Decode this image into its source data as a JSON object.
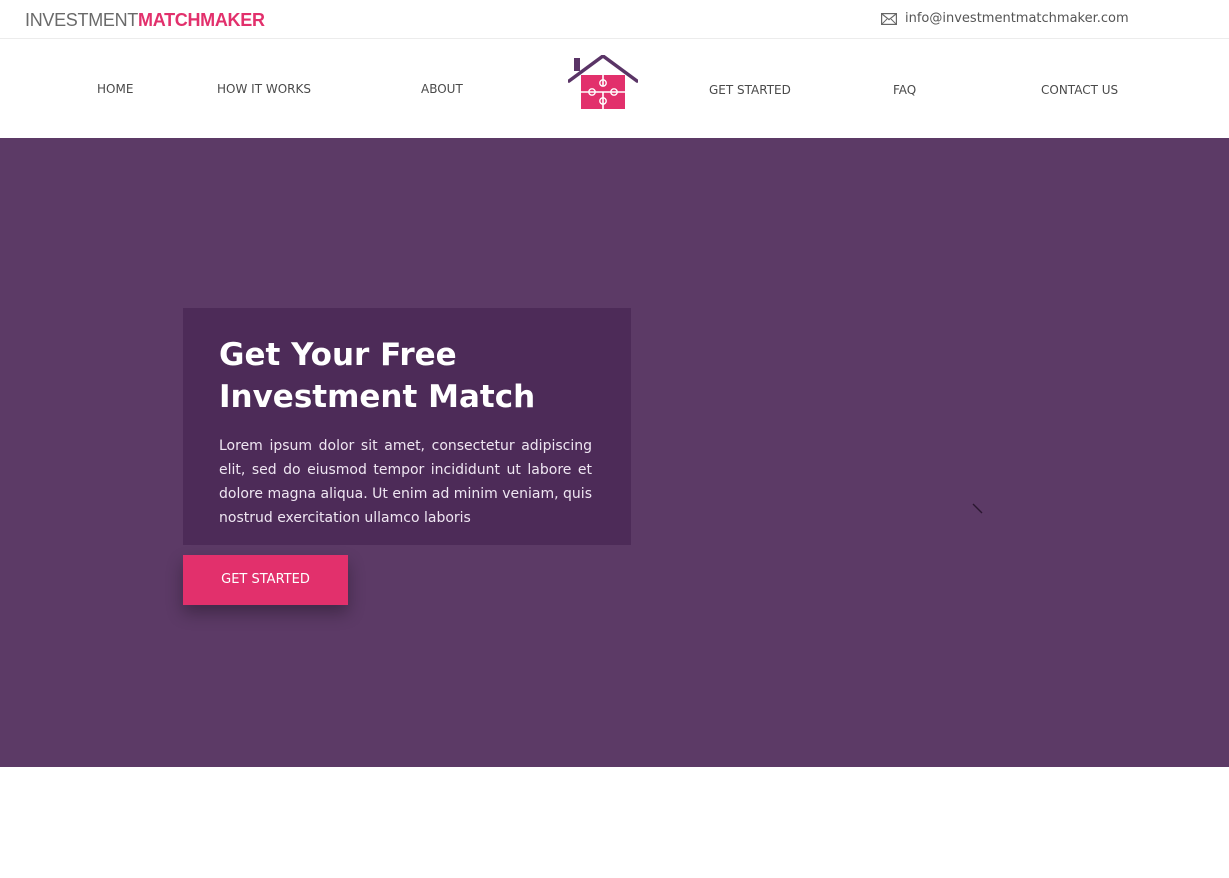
{
  "topbar": {
    "brand_part1": "INVESTMENT",
    "brand_part2": "MATCHMAKER",
    "email": "info@investmentmatchmaker.com",
    "email_icon": "envelope-icon"
  },
  "nav": {
    "home": "HOME",
    "how_it_works": "HOW IT WORKS",
    "about": "ABOUT",
    "get_started": "GET STARTED",
    "faq": "FAQ",
    "contact_us": "CONTACT US",
    "logo_icon": "house-puzzle-icon"
  },
  "hero": {
    "title_line1": "Get Your Free",
    "title_line2": "Investment Match",
    "body": "Lorem ipsum dolor sit amet, consectetur adipiscing elit, sed do eiusmod tempor incididunt ut labore et dolore magna aliqua. Ut enim ad minim veniam, quis nostrud exercitation ullamco laboris",
    "cta_label": "GET STARTED"
  },
  "colors": {
    "brand_pink": "#e2306c",
    "hero_bg": "#5c3a66",
    "card_bg": "#4d2b58",
    "logo_roof": "#5a3466"
  }
}
